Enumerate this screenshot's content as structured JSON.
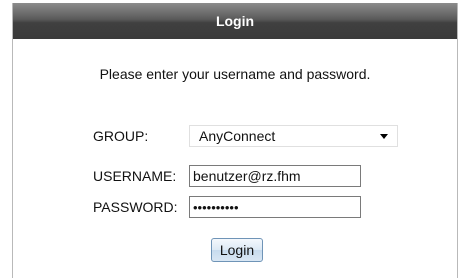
{
  "dialog": {
    "title": "Login",
    "prompt": "Please enter your username and password."
  },
  "form": {
    "group": {
      "label": "GROUP:",
      "selected": "AnyConnect"
    },
    "username": {
      "label": "USERNAME:",
      "value": "benutzer@rz.fhm"
    },
    "password": {
      "label": "PASSWORD:",
      "value": "••••••••••"
    }
  },
  "actions": {
    "login_label": "Login"
  }
}
